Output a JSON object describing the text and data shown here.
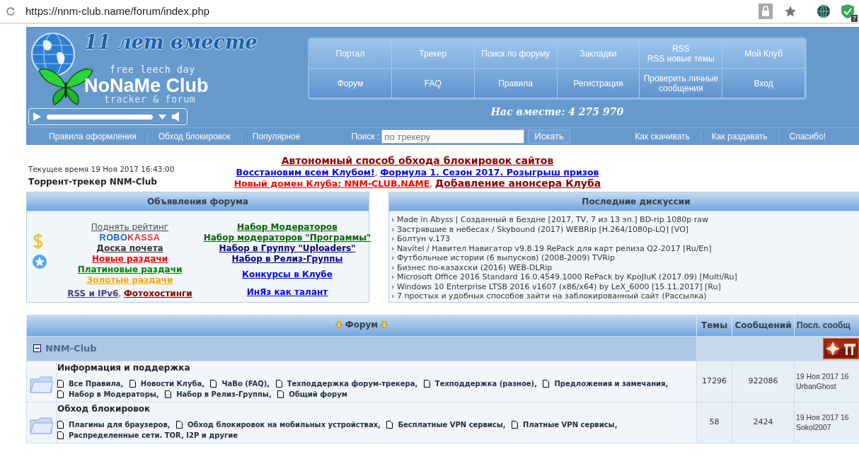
{
  "browser": {
    "url": "https://nnm-club.name/forum/index.php",
    "extension_badge": "7"
  },
  "logo": {
    "headline": "11 лет вместе",
    "tagline": "free leech day",
    "name": "NoNaMe Club",
    "subtitle": "tracker & forum"
  },
  "menu_rows": [
    [
      [
        "Портал"
      ],
      [
        "Трекер"
      ],
      [
        "Поиск по форуму"
      ],
      [
        "Закладки"
      ],
      [
        "RSS",
        "RSS новые темы"
      ],
      [
        "Мой Клуб"
      ]
    ],
    [
      [
        "Форум"
      ],
      [
        "FAQ"
      ],
      [
        "Правила"
      ],
      [
        "Регистрация"
      ],
      [
        "Проверить личные сообщения"
      ],
      [
        "Вход"
      ]
    ]
  ],
  "members_count": "Нас вместе: 4 275 970",
  "nav": {
    "left": [
      "Правила оформления",
      "Обход блокировок",
      "Популярное"
    ],
    "search": {
      "label": "Поиск :",
      "placeholder": "по трекеру",
      "button": "Искать"
    },
    "right": [
      "Как скачивать",
      "Как раздавать",
      "Спасибо!"
    ]
  },
  "site_time": "Текущее время 19 Ноя 2017 16:43:00",
  "site_title": "Торрент-трекер NNM-Club",
  "announcements": [
    [
      {
        "text": "Автономный способ обхода блокировок сайтов",
        "color": "#8b0000",
        "kind": "headline"
      }
    ],
    [
      {
        "text": "Восстановим всем Клубом!",
        "color": "#0000ff",
        "kind": "link"
      },
      {
        "text": ",",
        "kind": "separator"
      },
      {
        "text": "Формула 1. Сезон 2017. Розыгрыш призов",
        "color": "#0000ff",
        "kind": "link"
      }
    ],
    [
      {
        "text": "Новый домен Клуба: NNM-CLUB.NAME",
        "color": "#ff0000",
        "kind": "link"
      },
      {
        "text": ",",
        "kind": "separator"
      },
      {
        "text": "Добавление анонсера Клуба",
        "color": "#8b0000",
        "kind": "headline"
      }
    ]
  ],
  "notices": {
    "title": "Объявления форума",
    "left": [
      [
        {
          "text": "Поднять рейтинг",
          "color": "#4a4a4a",
          "kind": "plain"
        }
      ],
      [
        {
          "text": "ROBO",
          "color": "#1565c0",
          "kind": "logo"
        },
        {
          "text": "KASSA",
          "color": "#e53935",
          "kind": "logo"
        }
      ],
      [
        {
          "text": "Доска почета",
          "color": "#333333",
          "kind": "link"
        }
      ],
      [
        {
          "text": "Новые раздачи",
          "color": "#ff0000",
          "kind": "link"
        }
      ],
      [
        {
          "text": "Платиновые раздачи",
          "color": "#008000",
          "kind": "link"
        }
      ],
      [
        {
          "text": "Золотые раздачи",
          "color": "#ffa500",
          "kind": "link"
        }
      ],
      [
        {
          "text": "RSS и IPv6",
          "color": "#483d8b",
          "kind": "link"
        },
        {
          "text": ",",
          "kind": "separator"
        },
        {
          "text": "Фотохостинги",
          "color": "#800000",
          "kind": "link"
        }
      ]
    ],
    "right": [
      [
        {
          "text": "Набор Модераторов",
          "color": "#006400",
          "kind": "link"
        }
      ],
      [
        {
          "text": "Набор модераторов \"Программы\"",
          "color": "#006400",
          "kind": "link"
        }
      ],
      [
        {
          "text": "Набор в Группу \"Uploaders\"",
          "color": "#000080",
          "kind": "link"
        }
      ],
      [
        {
          "text": "Набор в Релиз-Группы",
          "color": "#000080",
          "kind": "link"
        }
      ],
      [
        {
          "text": "Конкурсы в Клубе",
          "color": "#0000ff",
          "kind": "link"
        }
      ],
      [
        {
          "text": "ИнЯз как талант",
          "color": "#0000ff",
          "kind": "link"
        }
      ]
    ]
  },
  "recent": {
    "title": "Последние дискуссии",
    "items": [
      "› Made in Abyss | Созданный в Бездне [2017, TV, 7 из 13 эп.] BD-rip 1080p raw",
      "› Застрявшие в небесах / Skybound (2017) WEBRip [H.264/1080p-LQ] [VO]",
      "› Болтун v.173",
      "› Navitel / Навител Навигатор v9.8.19 RePack для карт релиза Q2-2017 [Ru/En]",
      "› Футбольные истории (6 выпусков) (2008-2009) TVRip",
      "› Бизнес по-казахски (2016) WEB-DLRip",
      "› Microsoft Office 2016 Standard 16.0.4549.1000 RePack by KpoJIuK (2017.09) [Multi/Ru]",
      "› Windows 10 Enterprise LTSB 2016 v1607 (x86/x64) by LeX_6000 [15.11.2017] [Ru]",
      "› 7 простых и удобных способов зайти на заблокированный сайт (Рассылка)"
    ]
  },
  "forum_table": {
    "columns": [
      "Форум",
      "Темы",
      "Сообщений",
      "Посл. сообщ"
    ],
    "categories": [
      {
        "name": "NNM-Club",
        "expanded": true,
        "forums": [
          {
            "title": "Информация и поддержка",
            "subforums": [
              "Все Правила,",
              "Новости Клуба,",
              "ЧаВо (FAQ),",
              "Техподдержка форум-трекера,",
              "Техподдержка (разное),",
              "Предложения и замечания,",
              "Набор в Модераторы,",
              "Набор в Релиз-Группы,",
              "Общий форум"
            ],
            "topics": "17296",
            "posts": "922086",
            "last_post_date": "19 Ноя 2017 16",
            "last_post_author": "UrbanGhost"
          },
          {
            "title": "Обход блокировок",
            "subforums": [
              "Плагины для браузеров,",
              "Обход блокировок на мобильных устройствах,",
              "Бесплатные VPN сервисы,",
              "Платные VPN сервисы,",
              "Распределенные сети. TOR, I2P и другие"
            ],
            "topics": "58",
            "posts": "2424",
            "last_post_date": "19 Ноя 2017 16",
            "last_post_author": "Sokol2007"
          }
        ]
      }
    ]
  }
}
